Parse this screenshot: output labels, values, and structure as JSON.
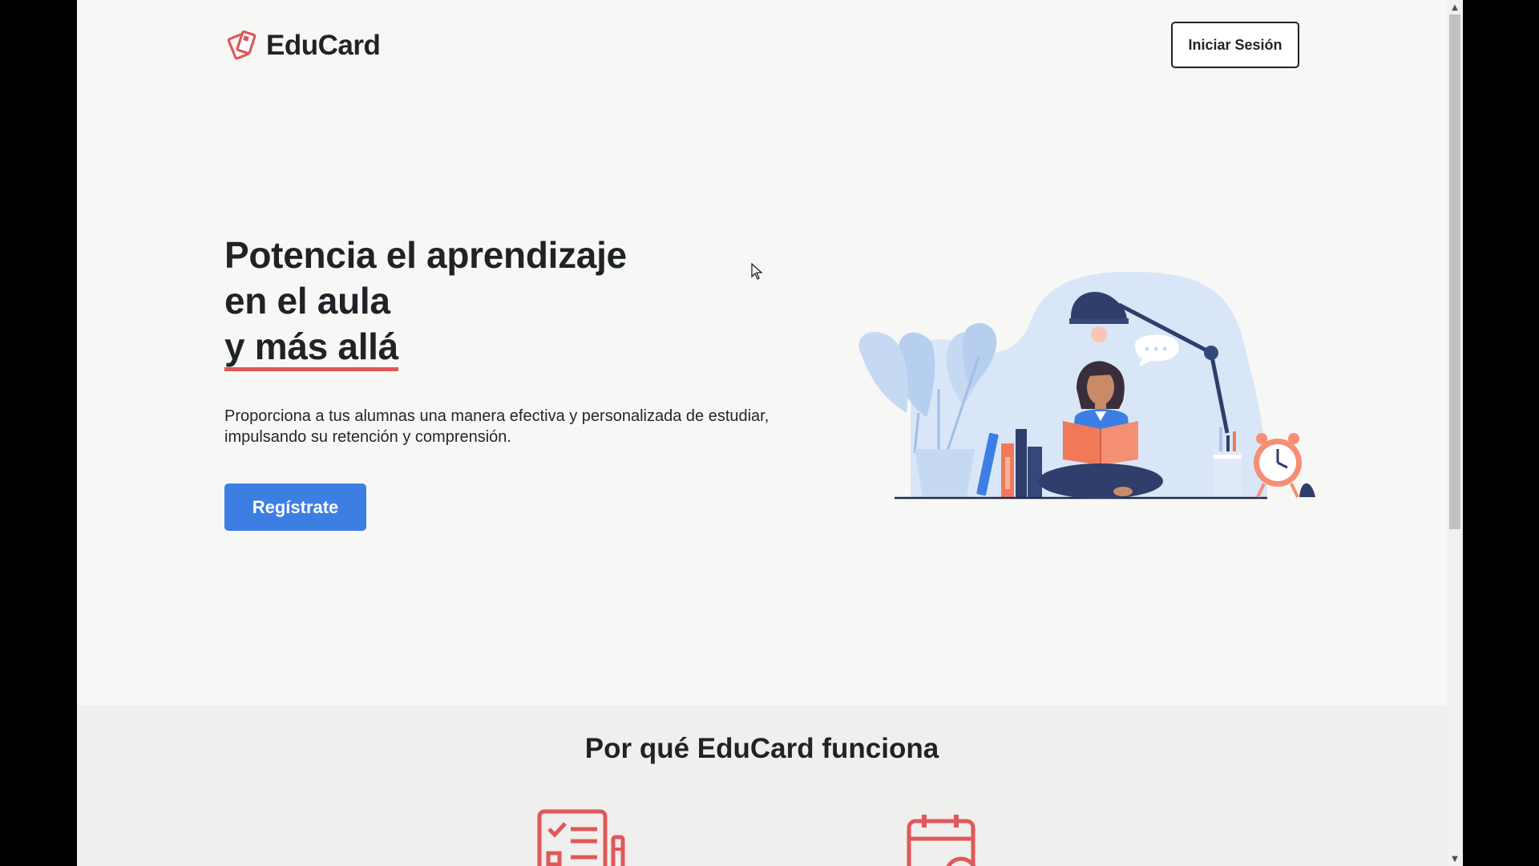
{
  "brand": {
    "name": "EduCard",
    "accent_color": "#e0585a",
    "primary_color": "#3d7ee3"
  },
  "header": {
    "login_label": "Iniciar Sesión"
  },
  "hero": {
    "title_line1": "Potencia el aprendizaje",
    "title_line2": "en el aula",
    "title_line3": "y más allá",
    "description": "Proporciona a tus alumnas una manera efectiva y personalizada de estudiar, impulsando su retención y comprensión.",
    "cta_label": "Regístrate",
    "illustration": "student-reading-illustration"
  },
  "features": {
    "title": "Por qué EduCard funciona",
    "icons": [
      "checklist-icon",
      "calendar-icon"
    ]
  },
  "icons": {
    "logo": "cards-logo-icon",
    "cursor": "mouse-pointer-icon",
    "scroll_up": "chevron-up-icon",
    "scroll_down": "chevron-down-icon"
  }
}
